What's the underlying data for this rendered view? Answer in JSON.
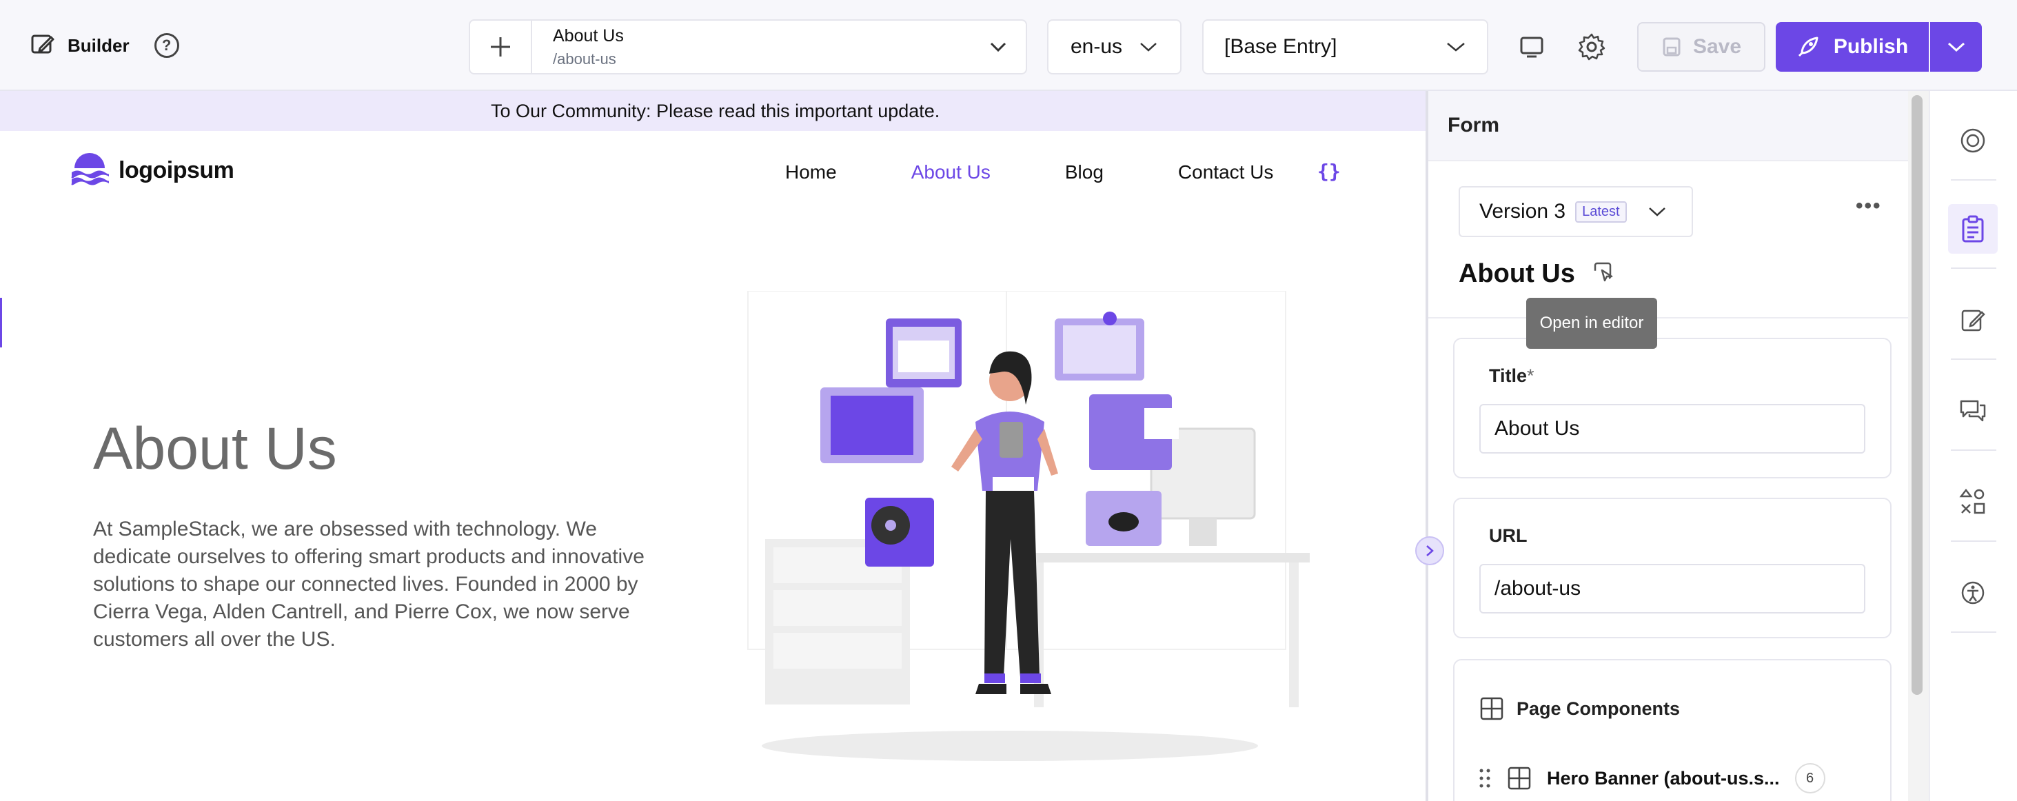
{
  "topbar": {
    "brand_label": "Builder",
    "help_label": "?",
    "page": {
      "name": "About Us",
      "url": "/about-us"
    },
    "locale": "en-us",
    "entry": "[Base Entry]",
    "save_label": "Save",
    "publish_label": "Publish"
  },
  "preview": {
    "announcement": "To Our Community: Please read this important update.",
    "logo_text": "logoipsum",
    "nav": [
      "Home",
      "About Us",
      "Blog",
      "Contact Us"
    ],
    "nav_active": "About Us",
    "code_icon": "{}",
    "hero_title": "About Us",
    "hero_text": "At SampleStack, we are obsessed with technology. We dedicate ourselves to offering smart products and innovative solutions to shape our connected lives. Founded in 2000 by Cierra Vega, Alden Cantrell, and Pierre Cox, we now serve customers all over the US."
  },
  "form": {
    "header": "Form",
    "version_label": "Version 3",
    "version_badge": "Latest",
    "entry_title": "About Us",
    "tooltip": "Open in editor",
    "fields": {
      "title_label": "Title",
      "title_required": "*",
      "title_value": "About Us",
      "url_label": "URL",
      "url_value": "/about-us"
    },
    "components": {
      "label": "Page Components",
      "items": [
        {
          "label": "Hero Banner (about-us.s...",
          "count": "6"
        }
      ]
    }
  },
  "colors": {
    "accent": "#6c47e6",
    "announce_bg": "#ede9fb",
    "topbar_bg": "#f7f7fb"
  },
  "rail_icons": [
    "target-icon",
    "clipboard-icon",
    "edit-icon",
    "comments-icon",
    "components-icon",
    "accessibility-icon"
  ]
}
